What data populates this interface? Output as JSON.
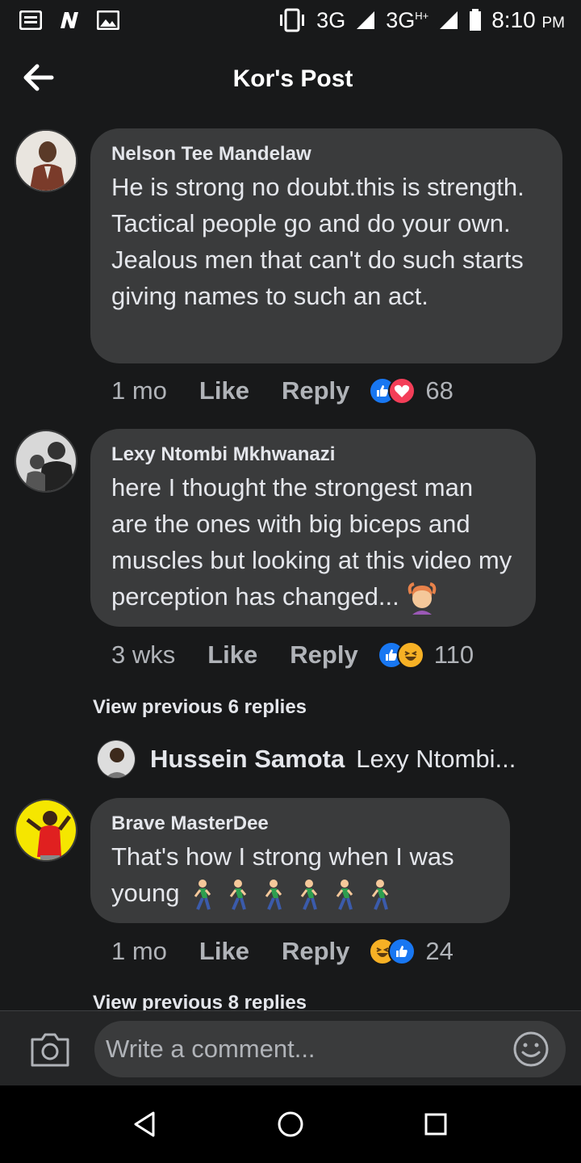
{
  "status_bar": {
    "network_1": "3G",
    "network_2": "3G",
    "network_2_sup": "H+",
    "time": "8:10",
    "ampm": "PM"
  },
  "header": {
    "title": "Kor's Post"
  },
  "comments": [
    {
      "name": "Nelson Tee Mandelaw",
      "text": "He is strong no doubt.this is strength. Tactical people go and do your own. Jealous men that can't do such starts giving names to such an act.",
      "time": "1 mo",
      "like_label": "Like",
      "reply_label": "Reply",
      "reactions": [
        "like",
        "love"
      ],
      "reaction_count": "68"
    },
    {
      "name": "Lexy Ntombi Mkhwanazi",
      "text": "here I thought the strongest man are the ones with big biceps and muscles but looking at this video my perception has changed...",
      "text_emoji": "person-gesturing-ok",
      "time": "3 wks",
      "like_label": "Like",
      "reply_label": "Reply",
      "reactions": [
        "like",
        "haha"
      ],
      "reaction_count": "110"
    },
    {
      "name": "Brave MasterDee",
      "text": "That's how I strong when I was young",
      "text_emoji": "person-walking x6",
      "time": "1 mo",
      "like_label": "Like",
      "reply_label": "Reply",
      "reactions": [
        "haha",
        "like"
      ],
      "reaction_count": "24"
    }
  ],
  "view_previous_1": "View previous 6 replies",
  "reply_preview": {
    "name": "Hussein Samota",
    "text": "Lexy Ntombi..."
  },
  "view_previous_2": "View previous 8 replies",
  "composer": {
    "placeholder": "Write a comment..."
  },
  "colors": {
    "background": "#18191a",
    "bubble": "#3a3b3c",
    "like_blue": "#1877f2",
    "love_red": "#f33e58",
    "haha_yellow": "#f7b125"
  }
}
